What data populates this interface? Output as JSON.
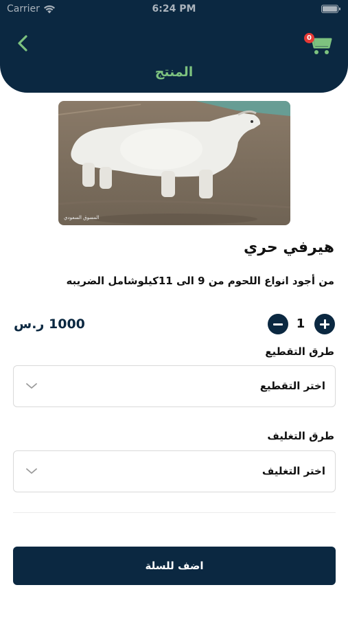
{
  "status_bar": {
    "carrier": "Carrier",
    "time": "6:24 PM"
  },
  "header": {
    "title": "المنتج",
    "cart_count": "0"
  },
  "product": {
    "name": "هيرفي حري",
    "description": "من أجود انواع اللحوم من 9 الى 11كيلوشامل الضريبه",
    "price": "1000 ر.س",
    "quantity": "1",
    "image_watermark": "المسوق السعودي"
  },
  "cutting": {
    "label": "طرق التقطيع",
    "placeholder": "اختر التقطيع"
  },
  "packaging": {
    "label": "طرق التغليف",
    "placeholder": "اختر التغليف"
  },
  "add_to_cart_label": "اضف للسلة",
  "colors": {
    "primary": "#0b2841",
    "accent": "#7dc27f",
    "badge": "#e53935"
  }
}
